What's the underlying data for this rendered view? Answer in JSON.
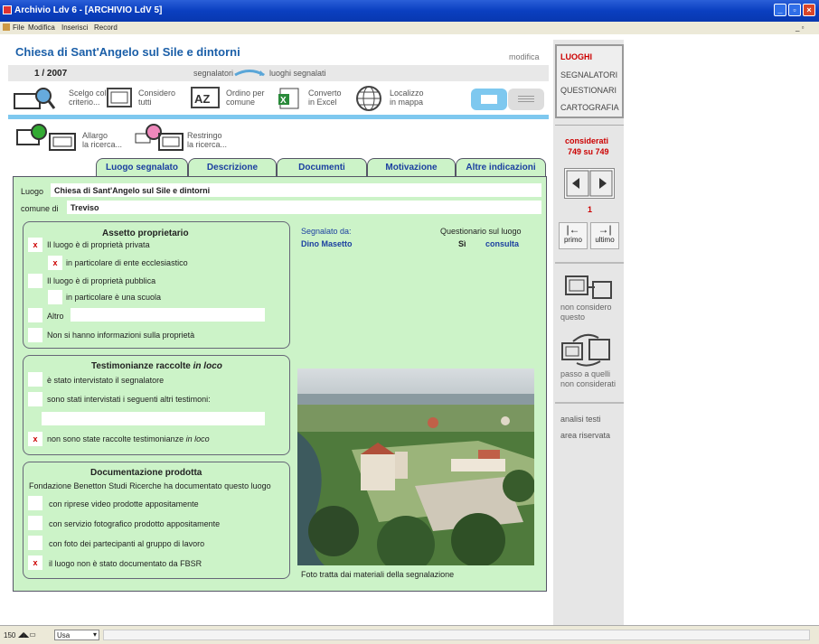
{
  "window": {
    "title": "Archivio Ldv 6 - [ARCHIVIO LdV 5]"
  },
  "menu": [
    "File",
    "Modifica",
    "Inserisci",
    "Record"
  ],
  "header": {
    "title": "Chiesa di Sant'Angelo sul Sile e dintorni",
    "modify": "modifica",
    "record": "1 / 2007",
    "segnalatori": "segnalatori",
    "luoghi_segnalati": "luoghi segnalati"
  },
  "toolbar": {
    "scelgo1": "Scelgo col",
    "scelgo2": "criterio...",
    "considero1": "Considero",
    "considero2": "tutti",
    "ordino1": "Ordino per",
    "ordino2": "comune",
    "converto1": "Converto",
    "converto2": "in Excel",
    "localizzo1": "Localizzo",
    "localizzo2": "in mappa",
    "allargo1": "Allargo",
    "allargo2": "la ricerca...",
    "restringo1": "Restringo",
    "restringo2": "la ricerca..."
  },
  "tabs": [
    "Luogo segnalato",
    "Descrizione",
    "Documenti",
    "Motivazione",
    "Altre indicazioni"
  ],
  "form": {
    "luogo_label": "Luogo",
    "luogo_value": "Chiesa di Sant'Angelo sul Sile e dintorni",
    "comune_label": "comune di",
    "comune_value": "Treviso"
  },
  "assetto": {
    "title": "Assetto proprietario",
    "item1": "Il luogo è di proprietà privata",
    "item2": "in particolare di ente ecclesiastico",
    "item3": "Il luogo è di proprietà pubblica",
    "item4": "in particolare è una scuola",
    "item5": "Altro",
    "item6": "Non si hanno informazioni sulla proprietà"
  },
  "testimonianze": {
    "title": "Testimonianze raccolte",
    "title_em": "in loco",
    "item1": "è stato intervistato il segnalatore",
    "item2": "sono stati intervistati i seguenti altri testimoni:",
    "item3": "non sono state raccolte testimonianze",
    "item3_em": "in loco"
  },
  "documentazione": {
    "title": "Documentazione prodotta",
    "subtitle": "Fondazione Benetton Studi Ricerche ha documentato questo luogo",
    "item1": "con riprese video prodotte appositamente",
    "item2": "con servizio fotografico prodotto appositamente",
    "item3": "con foto dei partecipanti al gruppo di lavoro",
    "item4": "il luogo non è stato documentato da FBSR"
  },
  "segnalato": {
    "label": "Segnalato da:",
    "name": "Dino Masetto",
    "quest_label": "Questionario sul luogo",
    "quest_value": "Sì",
    "consulta": "consulta"
  },
  "photo": {
    "caption": "Foto tratta dai materiali della segnalazione"
  },
  "check_mark": "x",
  "sidebar": {
    "luoghi": "LUOGHI",
    "segnalatori": "SEGNALATORI",
    "questionari": "QUESTIONARI",
    "cartografia": "CARTOGRAFIA",
    "considerati1": "considerati",
    "considerati2": "749 su 749",
    "page": "1",
    "primo": "primo",
    "ultimo": "ultimo",
    "non_considero1": "non considero",
    "non_considero2": "questo",
    "passo1": "passo a quelli",
    "passo2": "non considerati",
    "analisi": "analisi testi",
    "area": "area riservata"
  },
  "status": {
    "zoom": "150",
    "mode": "Usa"
  }
}
